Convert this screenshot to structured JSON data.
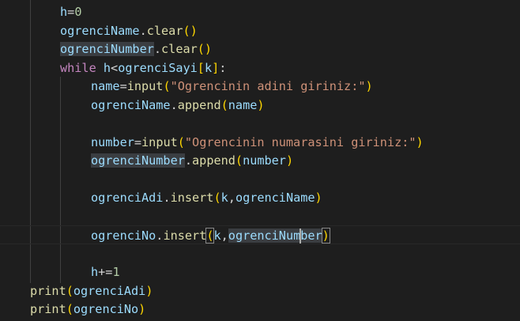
{
  "editor": {
    "lines": [
      {
        "indent": 0,
        "tokens": [
          {
            "t": "h",
            "c": "var"
          },
          {
            "t": "=",
            "c": "op"
          },
          {
            "t": "0",
            "c": "num"
          }
        ]
      },
      {
        "indent": 0,
        "tokens": [
          {
            "t": "ogrenciName",
            "c": "var"
          },
          {
            "t": ".",
            "c": "op"
          },
          {
            "t": "clear",
            "c": "fn"
          },
          {
            "t": "()",
            "c": "p1"
          }
        ]
      },
      {
        "indent": 0,
        "tokens": [
          {
            "t": "ogrenciNumber",
            "c": "var hl"
          },
          {
            "t": ".",
            "c": "op"
          },
          {
            "t": "clear",
            "c": "fn"
          },
          {
            "t": "()",
            "c": "p1"
          }
        ]
      },
      {
        "indent": 0,
        "tokens": [
          {
            "t": "while",
            "c": "kw"
          },
          {
            "t": " ",
            "c": "op"
          },
          {
            "t": "h",
            "c": "var"
          },
          {
            "t": "<",
            "c": "op"
          },
          {
            "t": "ogrenciSayi",
            "c": "var"
          },
          {
            "t": "[",
            "c": "p1"
          },
          {
            "t": "k",
            "c": "var"
          },
          {
            "t": "]",
            "c": "p1"
          },
          {
            "t": ":",
            "c": "op"
          }
        ]
      },
      {
        "indent": 1,
        "tokens": [
          {
            "t": "name",
            "c": "var"
          },
          {
            "t": "=",
            "c": "op"
          },
          {
            "t": "input",
            "c": "fn"
          },
          {
            "t": "(",
            "c": "p1"
          },
          {
            "t": "\"Ogrencinin adini giriniz:\"",
            "c": "str"
          },
          {
            "t": ")",
            "c": "p1"
          }
        ]
      },
      {
        "indent": 1,
        "tokens": [
          {
            "t": "ogrenciName",
            "c": "var"
          },
          {
            "t": ".",
            "c": "op"
          },
          {
            "t": "append",
            "c": "fn"
          },
          {
            "t": "(",
            "c": "p1"
          },
          {
            "t": "name",
            "c": "var"
          },
          {
            "t": ")",
            "c": "p1"
          }
        ]
      },
      {
        "indent": 1,
        "tokens": []
      },
      {
        "indent": 1,
        "tokens": [
          {
            "t": "number",
            "c": "var"
          },
          {
            "t": "=",
            "c": "op"
          },
          {
            "t": "input",
            "c": "fn"
          },
          {
            "t": "(",
            "c": "p1"
          },
          {
            "t": "\"Ogrencinin numarasini giriniz:\"",
            "c": "str"
          },
          {
            "t": ")",
            "c": "p1"
          }
        ]
      },
      {
        "indent": 1,
        "tokens": [
          {
            "t": "ogrenciNumber",
            "c": "var hl"
          },
          {
            "t": ".",
            "c": "op"
          },
          {
            "t": "append",
            "c": "fn"
          },
          {
            "t": "(",
            "c": "p1"
          },
          {
            "t": "number",
            "c": "var"
          },
          {
            "t": ")",
            "c": "p1"
          }
        ]
      },
      {
        "indent": 1,
        "tokens": []
      },
      {
        "indent": 1,
        "tokens": [
          {
            "t": "ogrenciAdi",
            "c": "var"
          },
          {
            "t": ".",
            "c": "op"
          },
          {
            "t": "insert",
            "c": "fn"
          },
          {
            "t": "(",
            "c": "p1"
          },
          {
            "t": "k",
            "c": "var"
          },
          {
            "t": ",",
            "c": "op"
          },
          {
            "t": "ogrenciName",
            "c": "var"
          },
          {
            "t": ")",
            "c": "p1"
          }
        ]
      },
      {
        "indent": 1,
        "tokens": []
      },
      {
        "indent": 1,
        "current": true,
        "tokens": [
          {
            "t": "ogrenciNo",
            "c": "var"
          },
          {
            "t": ".",
            "c": "op"
          },
          {
            "t": "insert",
            "c": "fn"
          },
          {
            "t": "(",
            "c": "p1 bracket-match"
          },
          {
            "t": "k",
            "c": "var"
          },
          {
            "t": ",",
            "c": "op"
          },
          {
            "t": "ogrenciNumber",
            "c": "var hl",
            "cursorAfter": 10
          },
          {
            "t": ")",
            "c": "p1 bracket-match"
          }
        ]
      },
      {
        "indent": 1,
        "tokens": []
      },
      {
        "indent": 1,
        "tokens": [
          {
            "t": "h",
            "c": "var"
          },
          {
            "t": "+=",
            "c": "op"
          },
          {
            "t": "1",
            "c": "num"
          }
        ]
      },
      {
        "indent": -1,
        "tokens": [
          {
            "t": "print",
            "c": "fn"
          },
          {
            "t": "(",
            "c": "p1"
          },
          {
            "t": "ogrenciAdi",
            "c": "var"
          },
          {
            "t": ")",
            "c": "p1"
          }
        ]
      },
      {
        "indent": -1,
        "tokens": [
          {
            "t": "print",
            "c": "fn"
          },
          {
            "t": "(",
            "c": "p1"
          },
          {
            "t": "ogrenciNo",
            "c": "var"
          },
          {
            "t": ")",
            "c": "p1"
          }
        ]
      }
    ]
  }
}
